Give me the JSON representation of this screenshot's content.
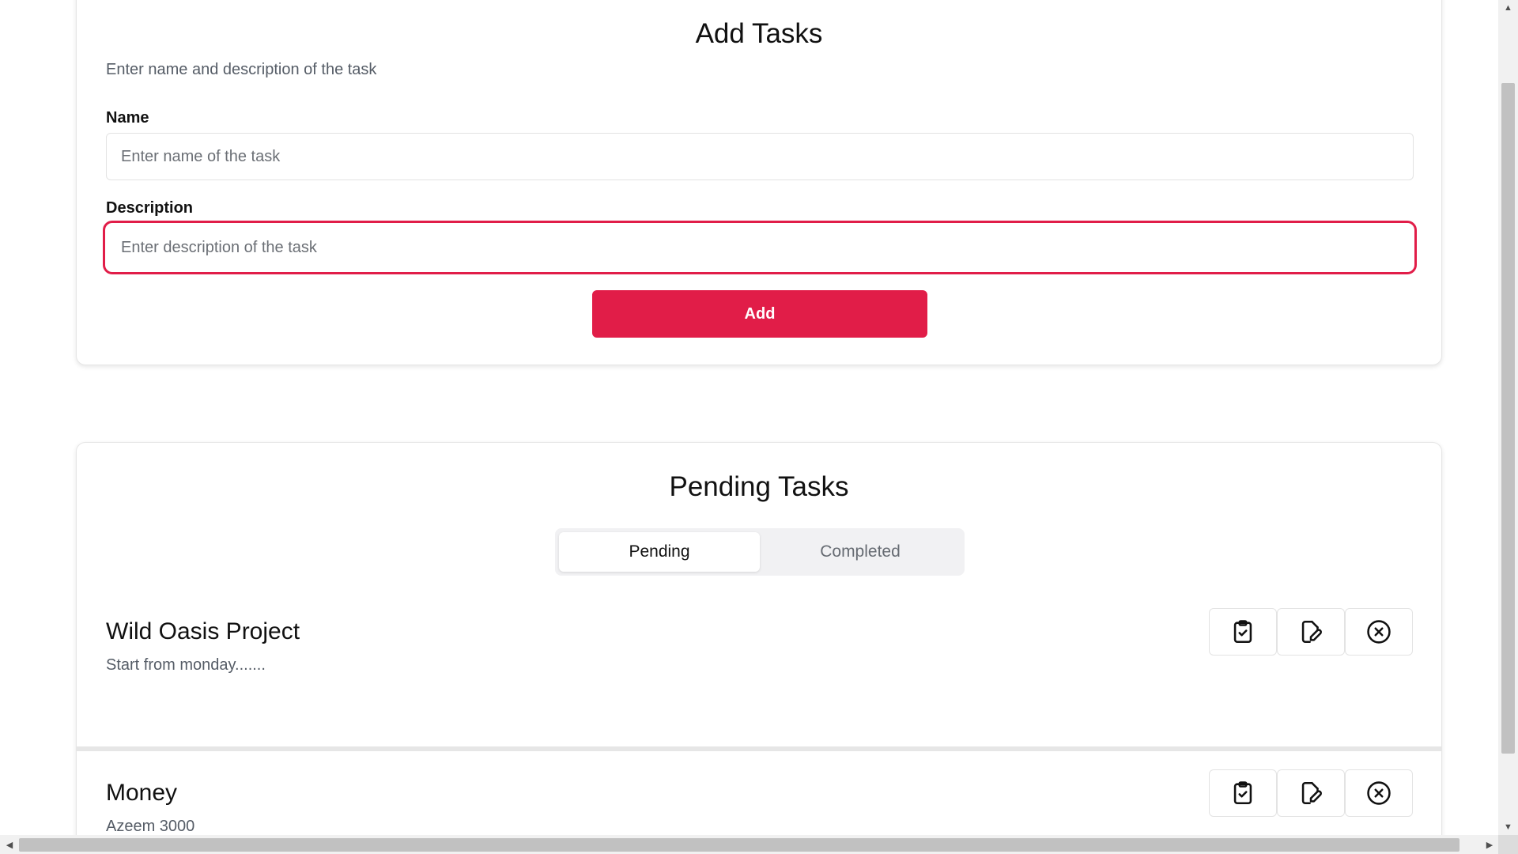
{
  "add_tasks": {
    "title": "Add Tasks",
    "subtitle": "Enter name and description of the task",
    "name_label": "Name",
    "name_placeholder": "Enter name of the task",
    "name_value": "",
    "description_label": "Description",
    "description_placeholder": "Enter description of the task",
    "description_value": "",
    "add_button_label": "Add"
  },
  "pending_tasks": {
    "title": "Pending Tasks",
    "tabs": [
      {
        "label": "Pending",
        "active": true
      },
      {
        "label": "Completed",
        "active": false
      }
    ],
    "tasks": [
      {
        "title": "Wild Oasis Project",
        "description": "Start from monday......."
      },
      {
        "title": "Money",
        "description": "Azeem 3000"
      }
    ],
    "actions": [
      {
        "icon": "clipboard-check-icon",
        "name": "complete-task-button"
      },
      {
        "icon": "edit-file-icon",
        "name": "edit-task-button"
      },
      {
        "icon": "circle-x-icon",
        "name": "delete-task-button"
      }
    ]
  },
  "colors": {
    "accent": "#e11d48",
    "text": "#111111",
    "muted": "#555c66",
    "border": "#e3e3e3",
    "tab_bg": "#f1f1f3"
  },
  "scrollbars": {
    "vertical": {
      "arrow_up": "▲",
      "arrow_down": "▼"
    },
    "horizontal": {
      "arrow_left": "◀",
      "arrow_right": "▶"
    }
  }
}
